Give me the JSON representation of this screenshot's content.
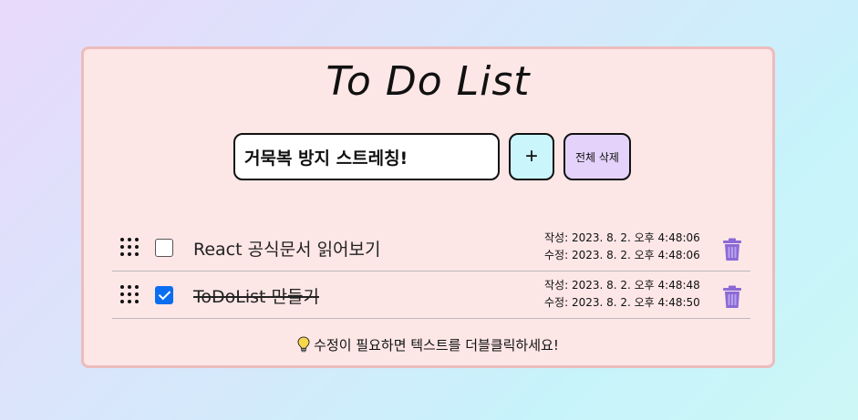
{
  "app": {
    "title": "To Do List",
    "input_value": "거묵복 방지 스트레칭!",
    "add_label": "+",
    "clear_all_label": "전체 삭제"
  },
  "todos": [
    {
      "text": "React 공식문서 읽어보기",
      "checked": false,
      "created": "작성: 2023. 8. 2. 오후 4:48:06",
      "modified": "수정: 2023. 8. 2. 오후 4:48:06"
    },
    {
      "text": "ToDoList 만들기",
      "checked": true,
      "created": "작성: 2023. 8. 2. 오후 4:48:48",
      "modified": "수정: 2023. 8. 2. 오후 4:48:50"
    }
  ],
  "hint": "수정이 필요하면 텍스트를 더블클릭하세요!",
  "colors": {
    "card_bg": "#fde6e6",
    "card_border": "#ecbcbc",
    "add_button": "#c9f5fb",
    "clear_button": "#e4d2fb",
    "trash": "#8b6ad6",
    "checkbox_checked": "#0b6ef0"
  },
  "icons": {
    "drag": "drag-handle-icon",
    "trash": "trash-icon",
    "hint": "lightbulb-icon"
  }
}
